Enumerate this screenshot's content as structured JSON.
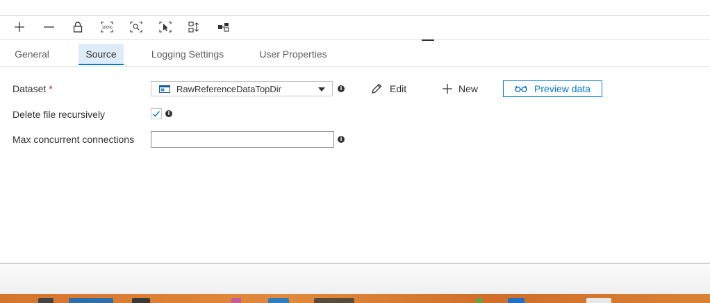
{
  "toolbar": {
    "icons": [
      "plus-icon",
      "minus-icon",
      "lock-icon",
      "zoom-100-icon",
      "zoom-to-fit-icon",
      "select-icon",
      "auto-align-icon",
      "layout-icon"
    ],
    "zoom_label": "100%"
  },
  "tabs": [
    {
      "label": "General",
      "active": false
    },
    {
      "label": "Source",
      "active": true
    },
    {
      "label": "Logging Settings",
      "active": false
    },
    {
      "label": "User Properties",
      "active": false
    }
  ],
  "form": {
    "dataset": {
      "label": "Dataset",
      "required_marker": "*",
      "selected_value": "RawReferenceDataTopDir",
      "info_glyph": "i"
    },
    "actions": {
      "edit_label": "Edit",
      "new_label": "New",
      "preview_label": "Preview data"
    },
    "delete_recursively": {
      "label": "Delete file recursively",
      "checked": true,
      "info_glyph": "i"
    },
    "max_concurrent": {
      "label": "Max concurrent connections",
      "value": "",
      "placeholder": "",
      "info_glyph": "i"
    }
  },
  "colors": {
    "accent": "#0078d4",
    "active_tab_bg": "#deecf9",
    "required": "#a4262c",
    "text": "#323130",
    "muted_text": "#605e5c"
  }
}
